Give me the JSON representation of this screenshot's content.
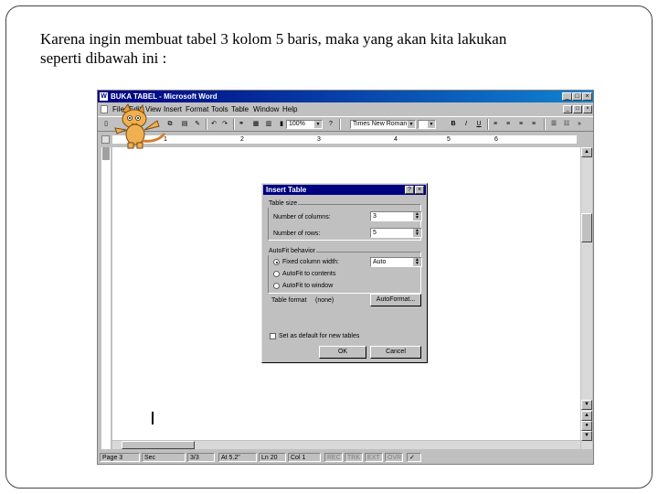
{
  "caption": {
    "line1": "Karena ingin membuat tabel 3 kolom 5 baris, maka yang akan kita lakukan",
    "line2": "seperti dibawah ini :"
  },
  "window": {
    "title": "BUKA TABEL - Microsoft Word",
    "min_icon": "_",
    "max_icon": "□",
    "close_icon": "×"
  },
  "menu": [
    "File",
    "Edit",
    "View",
    "Insert",
    "Format",
    "Tools",
    "Table",
    "Window",
    "Help"
  ],
  "toolbar": {
    "zoom": "100%",
    "font": "Times New Roman",
    "bold": "B",
    "italic": "I",
    "underline": "U"
  },
  "ruler": {
    "numbers": [
      "1",
      "2",
      "3",
      "4",
      "5",
      "6"
    ]
  },
  "statusbar": {
    "page": "Page 3",
    "sec": "Sec",
    "pages": "3/3",
    "at": "At 5.2\"",
    "ln": "Ln 20",
    "col": "Col 1",
    "rec": "REC",
    "trk": "TRK",
    "ext": "EXT",
    "ovr": "OVR"
  },
  "dialog": {
    "title": "Insert Table",
    "help_icon": "?",
    "close_icon": "×",
    "table_size_label": "Table size",
    "columns_label": "Number of columns:",
    "columns_value": "3",
    "rows_label": "Number of rows:",
    "rows_value": "5",
    "autofit_label": "AutoFit behavior",
    "fixed_label": "Fixed column width:",
    "fixed_value": "Auto",
    "contents_label": "AutoFit to contents",
    "window_label": "AutoFit to window",
    "format_label": "Table format",
    "format_value": "(none)",
    "autoformat_button": "AutoFormat...",
    "default_label": "Set as default for new tables",
    "ok_button": "OK",
    "cancel_button": "Cancel"
  }
}
